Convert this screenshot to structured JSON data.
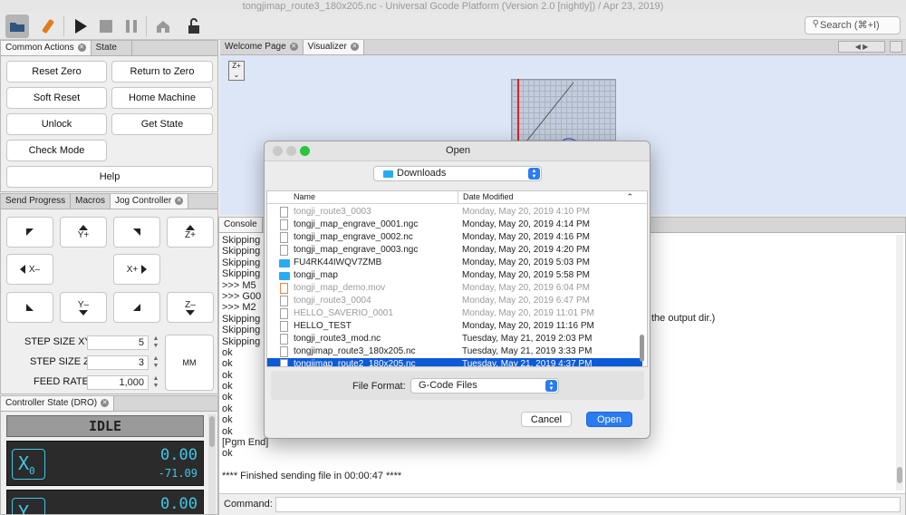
{
  "window": {
    "title": "tongjimap_route3_180x205.nc - Universal Gcode Platform (Version 2.0 [nightly])  / Apr 23, 2019)"
  },
  "toolbar": {
    "search_placeholder": "Search (⌘+I)"
  },
  "left_panel": {
    "tabs": [
      "Common Actions",
      "State"
    ],
    "actions": [
      "Reset Zero",
      "Return to Zero",
      "Soft Reset",
      "Home Machine",
      "Unlock",
      "Get State",
      "Check Mode",
      "Help"
    ]
  },
  "jog_panel": {
    "tabs": [
      "Send Progress",
      "Macros",
      "Jog Controller"
    ],
    "labels": {
      "yplus": "Y+",
      "zplus": "Z+",
      "xminus": "X–",
      "xplus": "X+",
      "yminus": "Y–",
      "zminus": "Z–",
      "mm": "MM"
    },
    "step_xy_label": "STEP SIZE XY",
    "step_xy_value": "5",
    "step_z_label": "STEP SIZE Z",
    "step_z_value": "3",
    "feed_label": "FEED RATE",
    "feed_value": "1,000"
  },
  "dro": {
    "tab": "Controller State (DRO)",
    "state": "IDLE",
    "x_label": "X",
    "x_sub": "0",
    "x_work": "0.00",
    "x_machine": "-71.09",
    "y_label": "Y",
    "y_sub": "0",
    "y_work": "0.00"
  },
  "editor_tabs": [
    "Welcome Page",
    "Visualizer"
  ],
  "visualizer": {
    "z_button": "Z+"
  },
  "console": {
    "tab": "Console",
    "lines": [
      "Skipping",
      "Skipping",
      "Skipping",
      "Skipping",
      ">>> M5",
      ">>> G00",
      ">>> M2",
      "Skipping",
      "Skipping",
      "Skipping",
      "ok",
      "ok",
      "ok",
      "ok",
      "ok",
      "ok",
      "ok",
      "ok",
      "[Pgm End]",
      "ok",
      "",
      "**** Finished sending file in 00:00:47 ****"
    ],
    "overflow_text": "the output dir.)",
    "command_label": "Command:"
  },
  "dialog": {
    "title": "Open",
    "location": "Downloads",
    "col_name": "Name",
    "col_date": "Date Modified",
    "files": [
      {
        "name": "tongji_route3_0003",
        "date": "Monday, May 20, 2019 4:10 PM",
        "type": "file",
        "dim": true
      },
      {
        "name": "tongji_map_engrave_0001.ngc",
        "date": "Monday, May 20, 2019 4:14 PM",
        "type": "file",
        "dim": false
      },
      {
        "name": "tongji_map_engrave_0002.nc",
        "date": "Monday, May 20, 2019 4:16 PM",
        "type": "file",
        "dim": false
      },
      {
        "name": "tongji_map_engrave_0003.ngc",
        "date": "Monday, May 20, 2019 4:20 PM",
        "type": "file",
        "dim": false
      },
      {
        "name": "FU4RK44IWQV7ZMB",
        "date": "Monday, May 20, 2019 5:03 PM",
        "type": "folder",
        "dim": false
      },
      {
        "name": "tongji_map",
        "date": "Monday, May 20, 2019 5:58 PM",
        "type": "folder",
        "dim": false
      },
      {
        "name": "tongji_map_demo.mov",
        "date": "Monday, May 20, 2019 6:04 PM",
        "type": "movie",
        "dim": true
      },
      {
        "name": "tongji_route3_0004",
        "date": "Monday, May 20, 2019 6:47 PM",
        "type": "file",
        "dim": true
      },
      {
        "name": "HELLO_SAVERIO_0001",
        "date": "Monday, May 20, 2019 11:01 PM",
        "type": "file",
        "dim": true
      },
      {
        "name": "HELLO_TEST",
        "date": "Monday, May 20, 2019 11:16 PM",
        "type": "file",
        "dim": false
      },
      {
        "name": "tongji_route3_mod.nc",
        "date": "Tuesday, May 21, 2019 2:03 PM",
        "type": "file",
        "dim": false
      },
      {
        "name": "tongjimap_route3_180x205.nc",
        "date": "Tuesday, May 21, 2019 3:33 PM",
        "type": "file",
        "dim": false
      },
      {
        "name": "tongjimap_route2_180x205.nc",
        "date": "Tuesday, May 21, 2019 4:37 PM",
        "type": "file",
        "dim": false,
        "selected": true
      }
    ],
    "format_label": "File Format:",
    "format_value": "G-Code Files",
    "cancel": "Cancel",
    "open": "Open"
  },
  "colors": {
    "accent": "#0b5ad8",
    "dro_text": "#3fc7e8",
    "folder": "#29aaf4",
    "red_line": "#e02020"
  }
}
